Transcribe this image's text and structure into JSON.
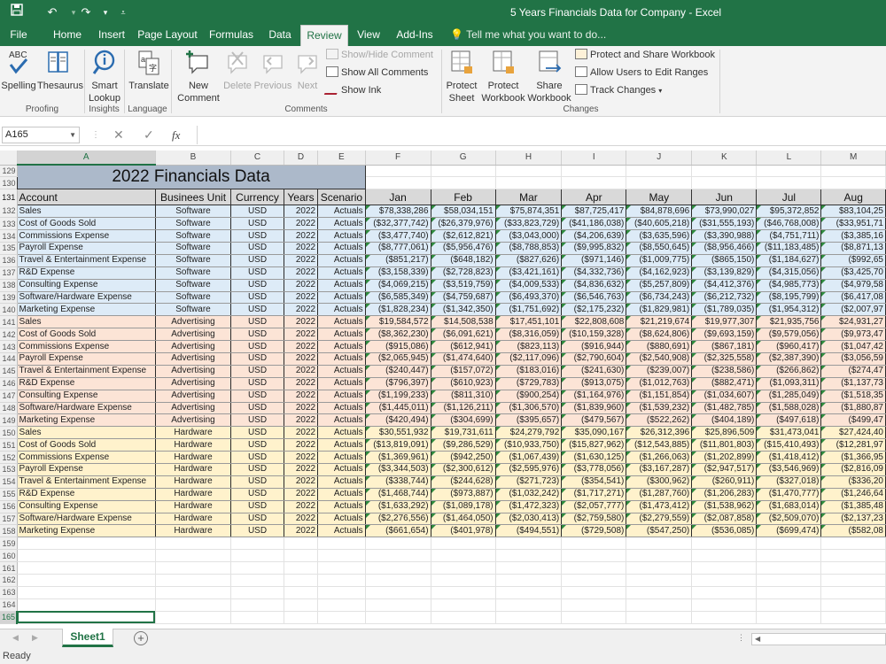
{
  "window": {
    "title": "5 Years Financials Data for Company - Excel"
  },
  "quick_access": {
    "save_icon": "save-icon",
    "undo_icon": "undo-icon",
    "redo_icon": "redo-icon",
    "customize_icon": "customize-icon"
  },
  "tabs": [
    {
      "label": "File"
    },
    {
      "label": "Home"
    },
    {
      "label": "Insert"
    },
    {
      "label": "Page Layout"
    },
    {
      "label": "Formulas"
    },
    {
      "label": "Data"
    },
    {
      "label": "Review"
    },
    {
      "label": "View"
    },
    {
      "label": "Add-Ins"
    }
  ],
  "tell_me": {
    "placeholder": "Tell me what you want to do..."
  },
  "ribbon": {
    "spelling": "Spelling",
    "thesaurus": "Thesaurus",
    "smart_lookup_1": "Smart",
    "smart_lookup_2": "Lookup",
    "translate": "Translate",
    "new_comment_1": "New",
    "new_comment_2": "Comment",
    "delete": "Delete",
    "previous": "Previous",
    "next": "Next",
    "show_hide_comment": "Show/Hide Comment",
    "show_all_comments": "Show All Comments",
    "show_ink": "Show Ink",
    "protect_sheet_1": "Protect",
    "protect_sheet_2": "Sheet",
    "protect_wb_1": "Protect",
    "protect_wb_2": "Workbook",
    "share_wb_1": "Share",
    "share_wb_2": "Workbook",
    "protect_share": "Protect and Share Workbook",
    "allow_users": "Allow Users to Edit Ranges",
    "track_changes": "Track Changes",
    "groups": {
      "proofing": "Proofing",
      "insights": "Insights",
      "language": "Language",
      "comments": "Comments",
      "changes": "Changes"
    }
  },
  "formula_bar": {
    "name_box": "A165",
    "fx": "fx",
    "cancel": "✕",
    "enter": "✓",
    "value": ""
  },
  "columns": [
    "A",
    "B",
    "C",
    "D",
    "E",
    "F",
    "G",
    "H",
    "I",
    "J",
    "K",
    "L",
    "M"
  ],
  "sheet": {
    "title": "2022 Financials Data",
    "headers": [
      "Account",
      "Businees Unit",
      "Currency",
      "Years",
      "Scenario",
      "Jan",
      "Feb",
      "Mar",
      "Apr",
      "May",
      "Jun",
      "Jul",
      "Aug"
    ],
    "header_row": "131",
    "title_rows": [
      "129",
      "130"
    ],
    "rows": [
      {
        "n": "132",
        "g": "sw",
        "a": "Sales",
        "b": "Software",
        "v": [
          "$78,338,286",
          "$58,034,151",
          "$75,874,351",
          "$87,725,417",
          "$84,878,696",
          "$73,990,027",
          "$95,372,852",
          "$83,104,25"
        ]
      },
      {
        "n": "133",
        "g": "sw",
        "a": "Cost of Goods Sold",
        "b": "Software",
        "v": [
          "($32,377,742)",
          "($26,379,976)",
          "($33,823,729)",
          "($41,186,038)",
          "($40,605,218)",
          "($31,555,193)",
          "($46,768,008)",
          "($33,951,71"
        ]
      },
      {
        "n": "134",
        "g": "sw",
        "a": "Commissions Expense",
        "b": "Software",
        "v": [
          "($3,477,740)",
          "($2,612,821)",
          "($3,043,000)",
          "($4,206,639)",
          "($3,635,596)",
          "($3,390,988)",
          "($4,751,711)",
          "($3,385,16"
        ]
      },
      {
        "n": "135",
        "g": "sw",
        "a": "Payroll Expense",
        "b": "Software",
        "v": [
          "($8,777,061)",
          "($5,956,476)",
          "($8,788,853)",
          "($9,995,832)",
          "($8,550,645)",
          "($8,956,466)",
          "($11,183,485)",
          "($8,871,13"
        ]
      },
      {
        "n": "136",
        "g": "sw",
        "a": "Travel & Entertainment Expense",
        "b": "Software",
        "v": [
          "($851,217)",
          "($648,182)",
          "($827,626)",
          "($971,146)",
          "($1,009,775)",
          "($865,150)",
          "($1,184,627)",
          "($992,65"
        ]
      },
      {
        "n": "137",
        "g": "sw",
        "a": "R&D Expense",
        "b": "Software",
        "v": [
          "($3,158,339)",
          "($2,728,823)",
          "($3,421,161)",
          "($4,332,736)",
          "($4,162,923)",
          "($3,139,829)",
          "($4,315,056)",
          "($3,425,70"
        ]
      },
      {
        "n": "138",
        "g": "sw",
        "a": "Consulting Expense",
        "b": "Software",
        "v": [
          "($4,069,215)",
          "($3,519,759)",
          "($4,009,533)",
          "($4,836,632)",
          "($5,257,809)",
          "($4,412,376)",
          "($4,985,773)",
          "($4,979,58"
        ]
      },
      {
        "n": "139",
        "g": "sw",
        "a": "Software/Hardware Expense",
        "b": "Software",
        "v": [
          "($6,585,349)",
          "($4,759,687)",
          "($6,493,370)",
          "($6,546,763)",
          "($6,734,243)",
          "($6,212,732)",
          "($8,195,799)",
          "($6,417,08"
        ]
      },
      {
        "n": "140",
        "g": "sw",
        "a": "Marketing Expense",
        "b": "Software",
        "v": [
          "($1,828,234)",
          "($1,342,350)",
          "($1,751,692)",
          "($2,175,232)",
          "($1,829,981)",
          "($1,789,035)",
          "($1,954,312)",
          "($2,007,97"
        ]
      },
      {
        "n": "141",
        "g": "ad",
        "a": "Sales",
        "b": "Advertising",
        "v": [
          "$19,584,572",
          "$14,508,538",
          "$17,451,101",
          "$22,808,608",
          "$21,219,674",
          "$19,977,307",
          "$21,935,756",
          "$24,931,27"
        ]
      },
      {
        "n": "142",
        "g": "ad",
        "a": "Cost of Goods Sold",
        "b": "Advertising",
        "v": [
          "($8,362,230)",
          "($6,091,621)",
          "($8,316,059)",
          "($10,159,328)",
          "($8,624,806)",
          "($9,693,159)",
          "($9,579,056)",
          "($9,973,47"
        ]
      },
      {
        "n": "143",
        "g": "ad",
        "a": "Commissions Expense",
        "b": "Advertising",
        "v": [
          "($915,086)",
          "($612,941)",
          "($823,113)",
          "($916,944)",
          "($880,691)",
          "($867,181)",
          "($960,417)",
          "($1,047,42"
        ]
      },
      {
        "n": "144",
        "g": "ad",
        "a": "Payroll Expense",
        "b": "Advertising",
        "v": [
          "($2,065,945)",
          "($1,474,640)",
          "($2,117,096)",
          "($2,790,604)",
          "($2,540,908)",
          "($2,325,558)",
          "($2,387,390)",
          "($3,056,59"
        ]
      },
      {
        "n": "145",
        "g": "ad",
        "a": "Travel & Entertainment Expense",
        "b": "Advertising",
        "v": [
          "($240,447)",
          "($157,072)",
          "($183,016)",
          "($241,630)",
          "($239,007)",
          "($238,586)",
          "($266,862)",
          "($274,47"
        ]
      },
      {
        "n": "146",
        "g": "ad",
        "a": "R&D Expense",
        "b": "Advertising",
        "v": [
          "($796,397)",
          "($610,923)",
          "($729,783)",
          "($913,075)",
          "($1,012,763)",
          "($882,471)",
          "($1,093,311)",
          "($1,137,73"
        ]
      },
      {
        "n": "147",
        "g": "ad",
        "a": "Consulting Expense",
        "b": "Advertising",
        "v": [
          "($1,199,233)",
          "($811,310)",
          "($900,254)",
          "($1,164,976)",
          "($1,151,854)",
          "($1,034,607)",
          "($1,285,049)",
          "($1,518,35"
        ]
      },
      {
        "n": "148",
        "g": "ad",
        "a": "Software/Hardware Expense",
        "b": "Advertising",
        "v": [
          "($1,445,011)",
          "($1,126,211)",
          "($1,306,570)",
          "($1,839,960)",
          "($1,539,232)",
          "($1,482,785)",
          "($1,588,028)",
          "($1,880,87"
        ]
      },
      {
        "n": "149",
        "g": "ad",
        "a": "Marketing Expense",
        "b": "Advertising",
        "v": [
          "($420,494)",
          "($304,699)",
          "($395,657)",
          "($479,567)",
          "($522,262)",
          "($404,189)",
          "($497,618)",
          "($499,47"
        ]
      },
      {
        "n": "150",
        "g": "hw",
        "a": "Sales",
        "b": "Hardware",
        "v": [
          "$30,551,932",
          "$19,731,611",
          "$24,279,792",
          "$35,090,167",
          "$26,312,396",
          "$25,896,509",
          "$31,473,041",
          "$27,424,40"
        ]
      },
      {
        "n": "151",
        "g": "hw",
        "a": "Cost of Goods Sold",
        "b": "Hardware",
        "v": [
          "($13,819,091)",
          "($9,286,529)",
          "($10,933,750)",
          "($15,827,962)",
          "($12,543,885)",
          "($11,801,803)",
          "($15,410,493)",
          "($12,281,97"
        ]
      },
      {
        "n": "152",
        "g": "hw",
        "a": "Commissions Expense",
        "b": "Hardware",
        "v": [
          "($1,369,961)",
          "($942,250)",
          "($1,067,439)",
          "($1,630,125)",
          "($1,266,063)",
          "($1,202,899)",
          "($1,418,412)",
          "($1,366,95"
        ]
      },
      {
        "n": "153",
        "g": "hw",
        "a": "Payroll Expense",
        "b": "Hardware",
        "v": [
          "($3,344,503)",
          "($2,300,612)",
          "($2,595,976)",
          "($3,778,056)",
          "($3,167,287)",
          "($2,947,517)",
          "($3,546,969)",
          "($2,816,09"
        ]
      },
      {
        "n": "154",
        "g": "hw",
        "a": "Travel & Entertainment Expense",
        "b": "Hardware",
        "v": [
          "($338,744)",
          "($244,628)",
          "($271,723)",
          "($354,541)",
          "($300,962)",
          "($260,911)",
          "($327,018)",
          "($336,20"
        ]
      },
      {
        "n": "155",
        "g": "hw",
        "a": "R&D Expense",
        "b": "Hardware",
        "v": [
          "($1,468,744)",
          "($973,887)",
          "($1,032,242)",
          "($1,717,271)",
          "($1,287,760)",
          "($1,206,283)",
          "($1,470,777)",
          "($1,246,64"
        ]
      },
      {
        "n": "156",
        "g": "hw",
        "a": "Consulting Expense",
        "b": "Hardware",
        "v": [
          "($1,633,292)",
          "($1,089,178)",
          "($1,472,323)",
          "($2,057,777)",
          "($1,473,412)",
          "($1,538,962)",
          "($1,683,014)",
          "($1,385,48"
        ]
      },
      {
        "n": "157",
        "g": "hw",
        "a": "Software/Hardware Expense",
        "b": "Hardware",
        "v": [
          "($2,276,556)",
          "($1,464,050)",
          "($2,030,413)",
          "($2,759,580)",
          "($2,279,559)",
          "($2,087,858)",
          "($2,509,070)",
          "($2,137,23"
        ]
      },
      {
        "n": "158",
        "g": "hw",
        "a": "Marketing Expense",
        "b": "Hardware",
        "v": [
          "($661,654)",
          "($401,978)",
          "($494,551)",
          "($729,508)",
          "($547,250)",
          "($536,085)",
          "($699,474)",
          "($582,08"
        ]
      }
    ],
    "currency": "USD",
    "year": "2022",
    "scenario": "Actuals",
    "empty_rows": [
      "159",
      "160",
      "161",
      "162",
      "163",
      "164",
      "165"
    ]
  },
  "sheet_tabs": [
    {
      "label": "Sheet1"
    }
  ],
  "status": {
    "text": "Ready"
  },
  "colors": {
    "accent": "#217346",
    "software": "#ddebf7",
    "advertising": "#fce4d6",
    "hardware": "#fff2cc",
    "title": "#acb9ca",
    "header": "#d9d9d9"
  }
}
